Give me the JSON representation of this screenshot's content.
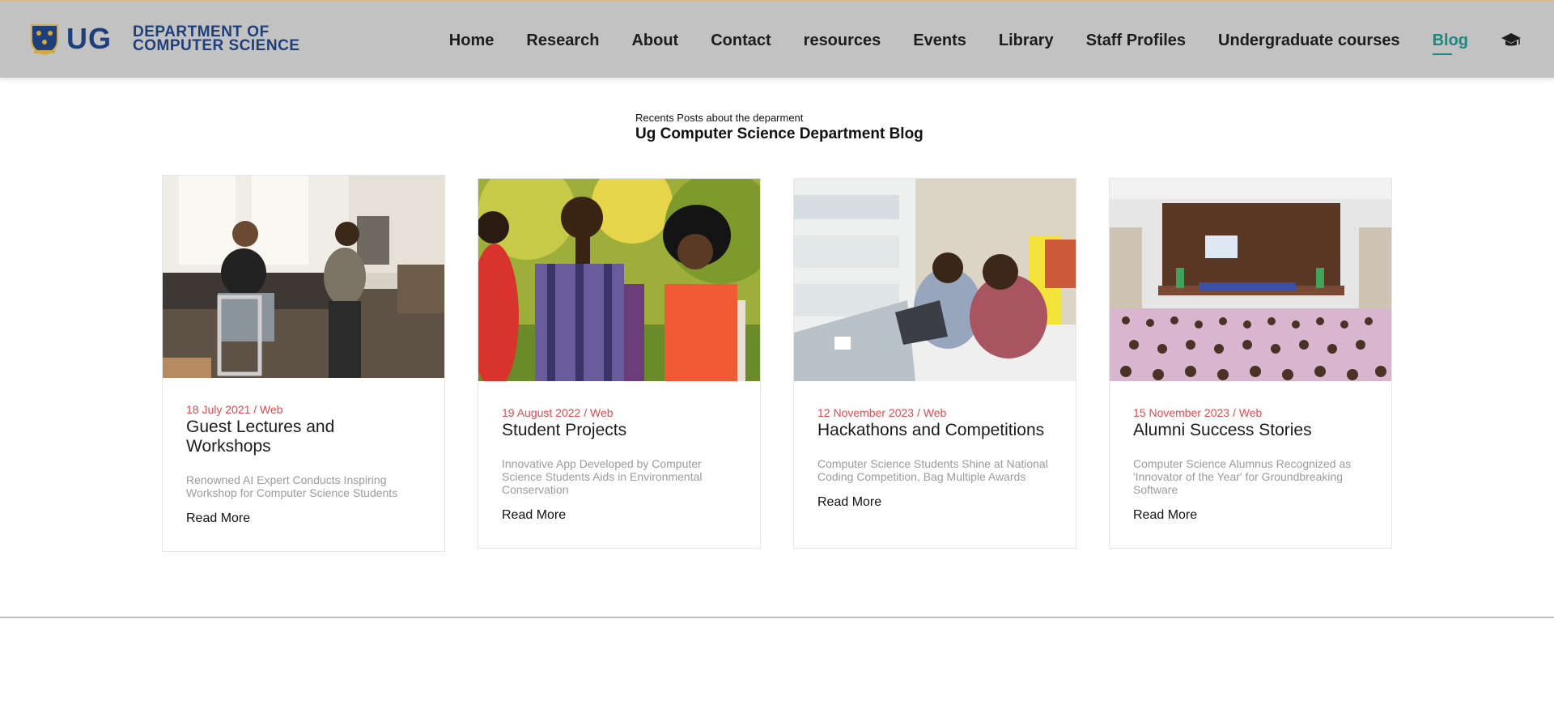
{
  "brand": {
    "short": "UG",
    "dept_line1": "DEPARTMENT OF",
    "dept_line2": "COMPUTER SCIENCE",
    "colors": {
      "navy": "#1f3f7a",
      "gold": "#d4a83a"
    }
  },
  "nav": {
    "items": [
      {
        "label": "Home"
      },
      {
        "label": "Research"
      },
      {
        "label": "About"
      },
      {
        "label": "Contact"
      },
      {
        "label": "resources"
      },
      {
        "label": "Events"
      },
      {
        "label": "Library"
      },
      {
        "label": "Staff Profiles"
      },
      {
        "label": "Undergraduate courses"
      },
      {
        "label": "Blog",
        "active": true
      }
    ],
    "icon": "graduation-cap-icon",
    "active_color": "#1a8a80"
  },
  "intro": {
    "subtitle": "Recents Posts about the deparment",
    "title": "Ug Computer Science Department Blog"
  },
  "posts": [
    {
      "date_category": "18 July 2021 / Web",
      "title": "Guest Lectures and Workshops",
      "excerpt": "Renowned AI Expert Conducts Inspiring Workshop for Computer Science Students",
      "read_more": "Read More",
      "image": "photo-meeting"
    },
    {
      "date_category": "19 August 2022 / Web",
      "title": "Student Projects",
      "excerpt": "Innovative App Developed by Computer Science Students Aids in Environmental Conservation",
      "read_more": "Read More",
      "image": "photo-students-outdoors"
    },
    {
      "date_category": "12 November 2023 / Web",
      "title": "Hackathons and Competitions",
      "excerpt": "Computer Science Students Shine at National Coding Competition, Bag Multiple Awards",
      "read_more": "Read More",
      "image": "photo-laptop-pair"
    },
    {
      "date_category": "15 November 2023 / Web",
      "title": "Alumni Success Stories",
      "excerpt": "Computer Science Alumnus Recognized as 'Innovator of the Year' for Groundbreaking Software",
      "read_more": "Read More",
      "image": "photo-auditorium"
    }
  ],
  "meta_color": "#e5494e"
}
